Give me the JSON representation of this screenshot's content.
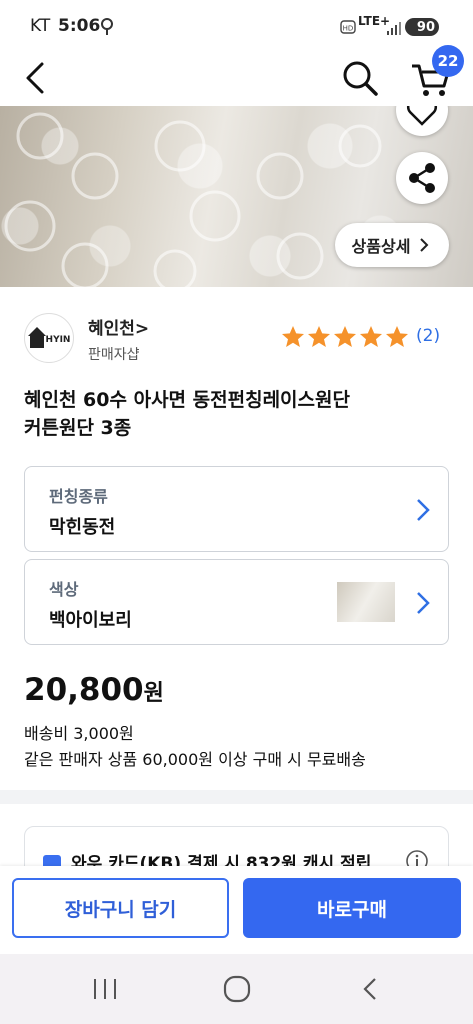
{
  "status_bar": {
    "carrier": "KT",
    "time": "5:06",
    "network": "LTE+",
    "battery": "90"
  },
  "header": {
    "cart_count": "22"
  },
  "hero": {
    "detail_button": "상품상세"
  },
  "seller": {
    "name": "혜인천",
    "sub": "판매자샵",
    "logo_text": "HYIN",
    "rating_stars": 5,
    "review_count": "(2)"
  },
  "product": {
    "title_line1": "혜인천 60수 아사면 동전펀칭레이스원단",
    "title_line2": "커튼원단 3종"
  },
  "options": [
    {
      "label": "펀칭종류",
      "value": "막힌동전"
    },
    {
      "label": "색상",
      "value": "백아이보리"
    }
  ],
  "price": {
    "amount": "20,800",
    "unit": "원",
    "shipping": "배송비 3,000원",
    "free_shipping": "같은 판매자 상품 60,000원 이상 구매 시 무료배송"
  },
  "promo": {
    "text": "와우 카드(KB) 결제 시 832원 캐시 적립"
  },
  "actions": {
    "cart": "장바구니 담기",
    "buy": "바로구매"
  },
  "colors": {
    "accent": "#3468f0",
    "star": "#f5922b",
    "link": "#2f6fe4"
  }
}
